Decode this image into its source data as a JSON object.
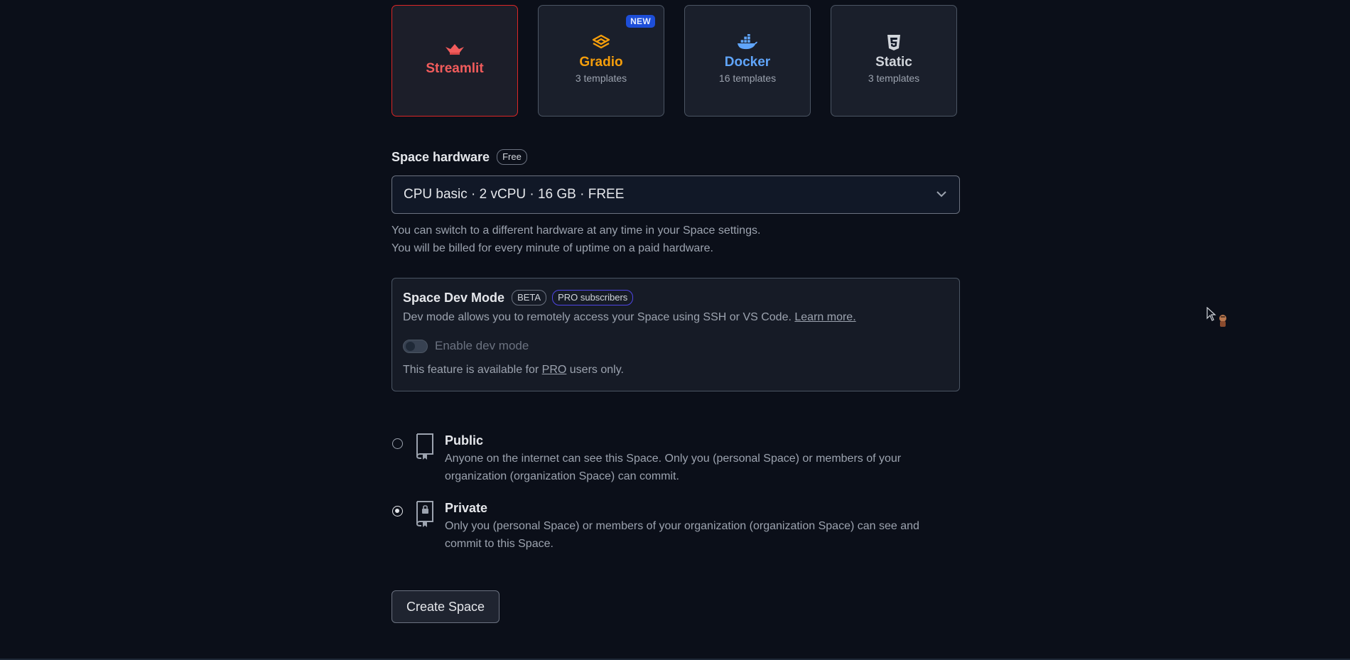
{
  "sdk": {
    "cards": [
      {
        "name": "Streamlit",
        "sub": "",
        "color": "#f25c5c",
        "icon": "streamlit-crown-icon",
        "selected": true
      },
      {
        "name": "Gradio",
        "sub": "3 templates",
        "color": "#f59e0b",
        "icon": "gradio-icon",
        "badge": "NEW"
      },
      {
        "name": "Docker",
        "sub": "16 templates",
        "color": "#60a5fa",
        "icon": "docker-whale-icon"
      },
      {
        "name": "Static",
        "sub": "3 templates",
        "color": "#d1d5db",
        "icon": "html5-icon"
      }
    ]
  },
  "hardware": {
    "label": "Space hardware",
    "badge": "Free",
    "selected": "CPU basic · 2 vCPU · 16 GB · FREE",
    "help_line1": "You can switch to a different hardware at any time in your Space settings.",
    "help_line2": "You will be billed for every minute of uptime on a paid hardware."
  },
  "dev_mode": {
    "title": "Space Dev Mode",
    "badge_beta": "BETA",
    "badge_pro": "PRO subscribers",
    "desc": "Dev mode allows you to remotely access your Space using SSH or VS Code.",
    "learn_more": "Learn more.",
    "toggle_label": "Enable dev mode",
    "toggle_on": false,
    "note_prefix": "This feature is available for",
    "note_link": "PRO",
    "note_suffix": "users only."
  },
  "visibility": {
    "public": {
      "title": "Public",
      "desc": "Anyone on the internet can see this Space. Only you (personal Space) or members of your organization (organization Space) can commit.",
      "checked": false
    },
    "private": {
      "title": "Private",
      "desc": "Only you (personal Space) or members of your organization (organization Space) can see and commit to this Space.",
      "checked": true
    }
  },
  "create_button": "Create Space"
}
